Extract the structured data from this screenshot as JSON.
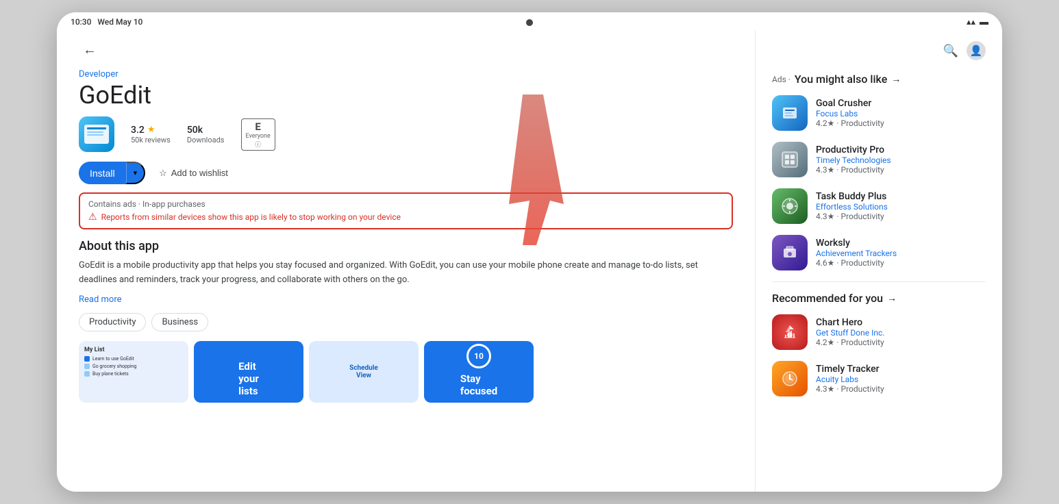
{
  "device": {
    "time": "10:30",
    "date": "Wed May 10",
    "camera_alt": "front camera"
  },
  "app": {
    "developer_label": "Developer",
    "title": "GoEdit",
    "rating": "3.2",
    "rating_star": "★",
    "reviews": "50k reviews",
    "downloads": "50k",
    "downloads_label": "Downloads",
    "age_rating": "Everyone",
    "install_label": "Install",
    "wishlist_label": "Add to wishlist",
    "warning_ads": "Contains ads · In-app purchases",
    "warning_message": "Reports from similar devices show this app is likely to stop working on your device",
    "about_title": "About this app",
    "about_text": "GoEdit is a mobile productivity app that helps you stay focused and organized. With GoEdit, you can use your mobile phone create and manage to-do lists, set deadlines and reminders, track your progress, and collaborate with others on the go.",
    "read_more": "Read more",
    "tag1": "Productivity",
    "tag2": "Business",
    "screenshot2_text": "Edit\nyour\nlists",
    "screenshot4_text": "Stay\nfocused",
    "clock_label": "10"
  },
  "sidebar": {
    "ads_label": "Ads ·",
    "you_might_like": "You might also like",
    "arrow": "→",
    "recommended": "Recommended for you",
    "apps": [
      {
        "name": "Goal Crusher",
        "developer": "Focus Labs",
        "rating": "4.2",
        "category": "Productivity"
      },
      {
        "name": "Productivity Pro",
        "developer": "Timely Technologies",
        "rating": "4.3",
        "category": "Productivity"
      },
      {
        "name": "Task Buddy Plus",
        "developer": "Effortless Solutions",
        "rating": "4.3",
        "category": "Productivity"
      },
      {
        "name": "Worksly",
        "developer": "Achievement Trackers",
        "rating": "4.6",
        "category": "Productivity"
      }
    ],
    "recommended_apps": [
      {
        "name": "Chart Hero",
        "developer": "Get Stuff Done Inc.",
        "rating": "4.2",
        "category": "Productivity"
      },
      {
        "name": "Timely Tracker",
        "developer": "Acuity Labs",
        "rating": "4.3",
        "category": "Productivity"
      }
    ]
  },
  "icons": {
    "back": "←",
    "search": "🔍",
    "profile": "👤",
    "wifi": "▲",
    "battery": "▬",
    "warning": "⚠",
    "wishlist": "☆",
    "dropdown": "▾"
  }
}
